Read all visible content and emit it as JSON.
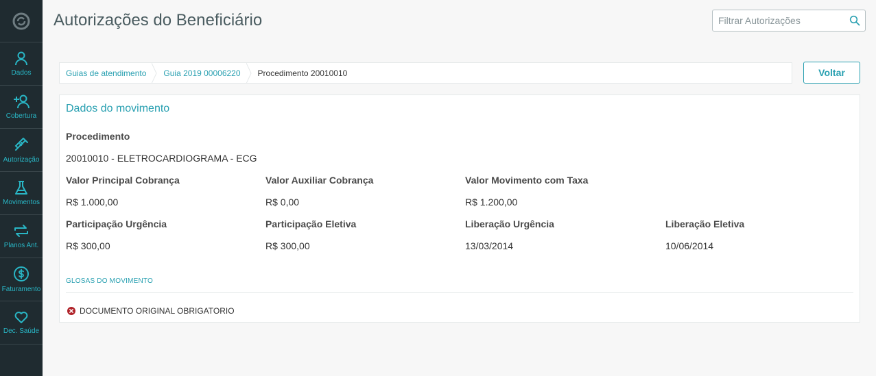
{
  "page": {
    "title": "Autorizações do Beneficiário"
  },
  "search": {
    "placeholder": "Filtrar Autorizações"
  },
  "sidebar": {
    "items": [
      {
        "label": "Dados",
        "icon": "user-icon"
      },
      {
        "label": "Cobertura",
        "icon": "add-user-icon"
      },
      {
        "label": "Autorização",
        "icon": "syringe-icon"
      },
      {
        "label": "Movimentos",
        "icon": "flask-icon"
      },
      {
        "label": "Planos Ant.",
        "icon": "swap-arrows-icon"
      },
      {
        "label": "Faturamento",
        "icon": "dollar-icon"
      },
      {
        "label": "Dec. Saúde",
        "icon": "heart-icon"
      }
    ]
  },
  "breadcrumb": {
    "items": [
      {
        "label": "Guias de atendimento"
      },
      {
        "label": "Guia 2019 00006220"
      },
      {
        "label": "Procedimento 20010010"
      }
    ]
  },
  "actions": {
    "back_label": "Voltar"
  },
  "movimento": {
    "title": "Dados do movimento",
    "procedimento_label": "Procedimento",
    "procedimento_value": "20010010 - ELETROCARDIOGRAMA - ECG",
    "fields": [
      {
        "label": "Valor Principal Cobrança",
        "value": "R$ 1.000,00"
      },
      {
        "label": "Valor Auxiliar Cobrança",
        "value": "R$ 0,00"
      },
      {
        "label": "Valor Movimento com Taxa",
        "value": "R$ 1.200,00"
      },
      {
        "label": "Participação Urgência",
        "value": "R$ 300,00"
      },
      {
        "label": "Participação Eletiva",
        "value": "R$ 300,00"
      },
      {
        "label": "Liberação Urgência",
        "value": "13/03/2014"
      },
      {
        "label": "Liberação Eletiva",
        "value": "10/06/2014"
      }
    ],
    "glosas_title": "GLOSAS DO MOVIMENTO",
    "glosas": [
      {
        "text": "DOCUMENTO ORIGINAL OBRIGATORIO"
      }
    ]
  },
  "colors": {
    "accent": "#29a0b1",
    "sidebar_bg": "#1f2b30",
    "error": "#b0232a"
  }
}
